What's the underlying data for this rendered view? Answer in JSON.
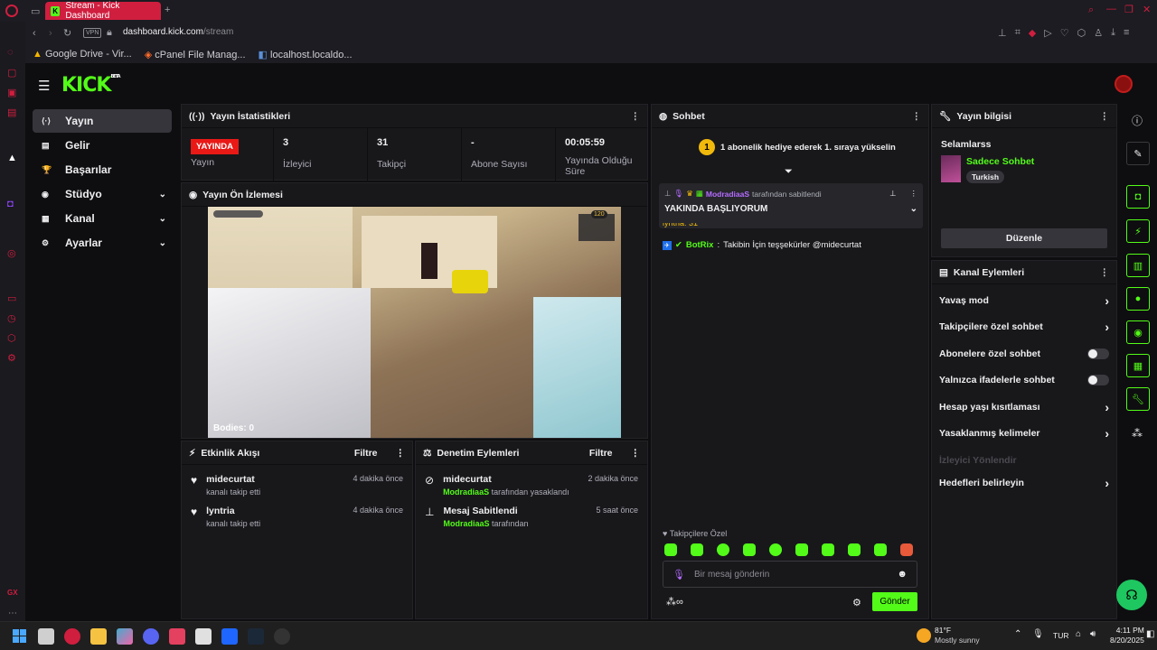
{
  "browser": {
    "tab_title": "Stream - Kick Dashboard",
    "tab_favicon": "K",
    "vpn_badge": "VPN",
    "url_host": "dashboard.kick.com",
    "url_path": "/stream",
    "bookmarks": [
      {
        "label": "Google Drive - Vir..."
      },
      {
        "label": "cPanel File Manag..."
      },
      {
        "label": "localhost.localdo..."
      }
    ]
  },
  "app": {
    "logo": "KICK",
    "logo_badge": "BETA",
    "accent": "#53fc18",
    "nav": [
      {
        "label": "Yayın",
        "icon": "broadcast-icon",
        "glyph": "⟨·⟩",
        "active": true,
        "chevron": false
      },
      {
        "label": "Gelir",
        "icon": "revenue-icon",
        "glyph": "▤",
        "active": false,
        "chevron": false
      },
      {
        "label": "Başarılar",
        "icon": "trophy-icon",
        "glyph": "🏆",
        "active": false,
        "chevron": false
      },
      {
        "label": "Stüdyo",
        "icon": "studio-icon",
        "glyph": "◉",
        "active": false,
        "chevron": true
      },
      {
        "label": "Kanal",
        "icon": "channel-icon",
        "glyph": "▦",
        "active": false,
        "chevron": true
      },
      {
        "label": "Ayarlar",
        "icon": "settings-icon",
        "glyph": "⚙",
        "active": false,
        "chevron": true
      }
    ]
  },
  "stats": {
    "title": "Yayın İstatistikleri",
    "live_badge": "YAYINDA",
    "cells": [
      {
        "value": "",
        "label": "Yayın"
      },
      {
        "value": "3",
        "label": "İzleyici"
      },
      {
        "value": "31",
        "label": "Takipçi"
      },
      {
        "value": "-",
        "label": "Abone Sayısı"
      },
      {
        "value": "00:05:59",
        "label": "Yayında Olduğu Süre"
      }
    ]
  },
  "preview": {
    "title": "Yayın Ön İzlemesi",
    "overlay_text": "Bodies: 0",
    "coin_count": "120"
  },
  "activity": {
    "title": "Etkinlik Akışı",
    "filter": "Filtre",
    "items": [
      {
        "name": "midecurtat",
        "sub": "kanalı takip etti",
        "when": "4 dakika önce"
      },
      {
        "name": "lyntria",
        "sub": "kanalı takip etti",
        "when": "4 dakika önce"
      }
    ]
  },
  "moderation": {
    "title": "Denetim Eylemleri",
    "filter": "Filtre",
    "items": [
      {
        "icon": "ban-icon",
        "name": "midecurtat",
        "actor": "ModradiaaS",
        "sub": "tarafından yasaklandı",
        "when": "2 dakika önce"
      },
      {
        "icon": "pin-icon",
        "name": "Mesaj Sabitlendi",
        "actor": "ModradiaaS",
        "sub": "tarafından",
        "when": "5 saat önce"
      }
    ]
  },
  "chat": {
    "title": "Sohbet",
    "gift_rank": "1",
    "gift_text": "1 abonelik hediye ederek 1. sıraya yükselin",
    "pinned_by": "ModradiaaS",
    "pinned_suffix": "tarafından sabitlendi",
    "pinned_message": "YAKINDA BAŞLIYORUM",
    "partial_line": "lyntria: 31",
    "messages": [
      {
        "user": "BotRix",
        "text": "Takibin İçin teşşekürler @midecurtat"
      }
    ],
    "followers_only_label": "Takipçilere Özel",
    "input_placeholder": "Bir mesaj gönderin",
    "send_label": "Gönder"
  },
  "stream_info": {
    "title": "Yayın bilgisi",
    "stream_title": "Selamlarss",
    "category": "Sadece Sohbet",
    "tag": "Turkish",
    "edit_label": "Düzenle"
  },
  "channel_actions": {
    "title": "Kanal Eylemleri",
    "rows": [
      {
        "label": "Yavaş mod",
        "control": "chevron"
      },
      {
        "label": "Takipçilere özel sohbet",
        "control": "chevron"
      },
      {
        "label": "Abonelere özel sohbet",
        "control": "toggle"
      },
      {
        "label": "Yalnızca ifadelerle sohbet",
        "control": "toggle"
      },
      {
        "label": "Hesap yaşı kısıtlaması",
        "control": "chevron"
      },
      {
        "label": "Yasaklanmış kelimeler",
        "control": "chevron"
      },
      {
        "label": "İzleyici Yönlendir",
        "control": "none",
        "disabled": true
      },
      {
        "label": "Hedefleri belirleyin",
        "control": "chevron"
      }
    ]
  },
  "taskbar": {
    "weather_temp": "81°F",
    "weather_desc": "Mostly sunny",
    "lang": "TUR",
    "time": "4:11 PM",
    "date": "8/20/2025"
  }
}
